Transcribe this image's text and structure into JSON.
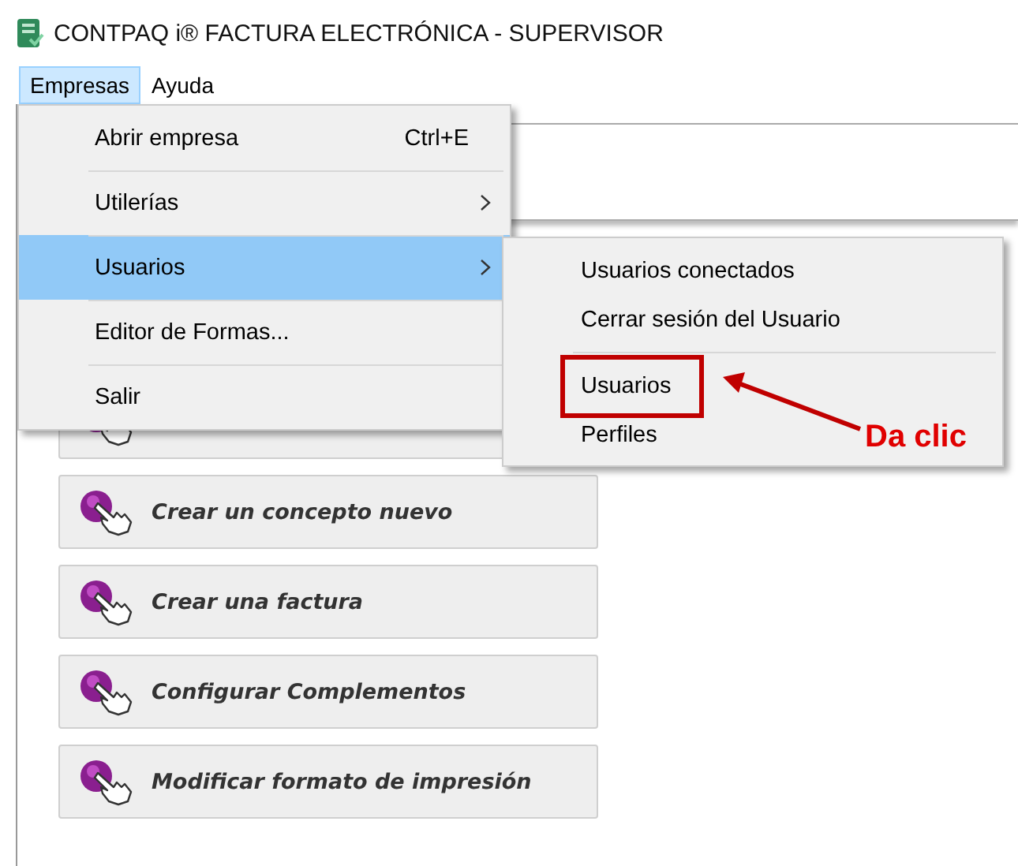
{
  "window": {
    "title": "CONTPAQ i® FACTURA ELECTRÓNICA  -  SUPERVISOR"
  },
  "menubar": [
    {
      "label": "Empresas",
      "selected": true
    },
    {
      "label": "Ayuda",
      "selected": false
    }
  ],
  "menu": [
    {
      "label": "Abrir empresa",
      "shortcut": "Ctrl+E",
      "submenu": false,
      "selected": false
    },
    {
      "label": "Utilerías",
      "submenu": true,
      "selected": false
    },
    {
      "label": "Usuarios",
      "submenu": true,
      "selected": true
    },
    {
      "label": "Editor de Formas...",
      "submenu": false,
      "selected": false
    },
    {
      "label": "Salir",
      "submenu": false,
      "selected": false
    }
  ],
  "submenu": [
    {
      "items": [
        {
          "label": "Usuarios conectados",
          "highlighted": false
        },
        {
          "label": "Cerrar sesión del Usuario",
          "highlighted": false
        }
      ]
    },
    {
      "items": [
        {
          "label": "Usuarios",
          "highlighted": true
        },
        {
          "label": "Perfiles",
          "highlighted": false
        }
      ]
    }
  ],
  "callout": {
    "text": "Da clic"
  },
  "actions": [
    {
      "kind": "covered"
    },
    {
      "kind": "labeled",
      "label": "Crear un concepto nuevo"
    },
    {
      "kind": "labeled",
      "label": "Crear una factura"
    },
    {
      "kind": "labeled",
      "label": "Configurar Complementos"
    },
    {
      "kind": "labeled",
      "label": "Modificar formato de impresión"
    }
  ]
}
